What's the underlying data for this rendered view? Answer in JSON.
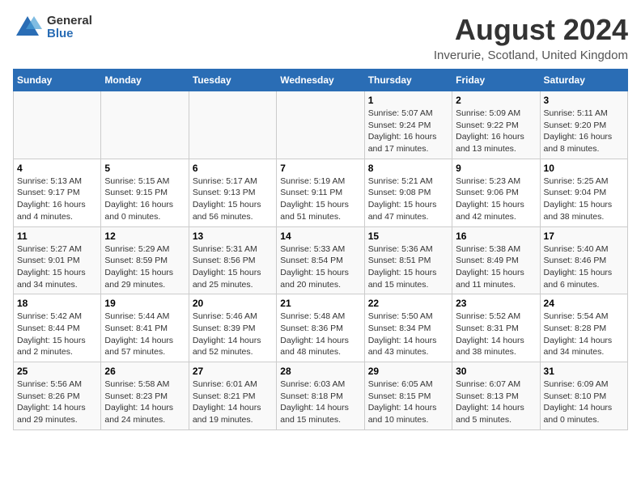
{
  "logo": {
    "general": "General",
    "blue": "Blue"
  },
  "title": "August 2024",
  "subtitle": "Inverurie, Scotland, United Kingdom",
  "days_of_week": [
    "Sunday",
    "Monday",
    "Tuesday",
    "Wednesday",
    "Thursday",
    "Friday",
    "Saturday"
  ],
  "weeks": [
    [
      {
        "day": "",
        "info": ""
      },
      {
        "day": "",
        "info": ""
      },
      {
        "day": "",
        "info": ""
      },
      {
        "day": "",
        "info": ""
      },
      {
        "day": "1",
        "info": "Sunrise: 5:07 AM\nSunset: 9:24 PM\nDaylight: 16 hours and 17 minutes."
      },
      {
        "day": "2",
        "info": "Sunrise: 5:09 AM\nSunset: 9:22 PM\nDaylight: 16 hours and 13 minutes."
      },
      {
        "day": "3",
        "info": "Sunrise: 5:11 AM\nSunset: 9:20 PM\nDaylight: 16 hours and 8 minutes."
      }
    ],
    [
      {
        "day": "4",
        "info": "Sunrise: 5:13 AM\nSunset: 9:17 PM\nDaylight: 16 hours and 4 minutes."
      },
      {
        "day": "5",
        "info": "Sunrise: 5:15 AM\nSunset: 9:15 PM\nDaylight: 16 hours and 0 minutes."
      },
      {
        "day": "6",
        "info": "Sunrise: 5:17 AM\nSunset: 9:13 PM\nDaylight: 15 hours and 56 minutes."
      },
      {
        "day": "7",
        "info": "Sunrise: 5:19 AM\nSunset: 9:11 PM\nDaylight: 15 hours and 51 minutes."
      },
      {
        "day": "8",
        "info": "Sunrise: 5:21 AM\nSunset: 9:08 PM\nDaylight: 15 hours and 47 minutes."
      },
      {
        "day": "9",
        "info": "Sunrise: 5:23 AM\nSunset: 9:06 PM\nDaylight: 15 hours and 42 minutes."
      },
      {
        "day": "10",
        "info": "Sunrise: 5:25 AM\nSunset: 9:04 PM\nDaylight: 15 hours and 38 minutes."
      }
    ],
    [
      {
        "day": "11",
        "info": "Sunrise: 5:27 AM\nSunset: 9:01 PM\nDaylight: 15 hours and 34 minutes."
      },
      {
        "day": "12",
        "info": "Sunrise: 5:29 AM\nSunset: 8:59 PM\nDaylight: 15 hours and 29 minutes."
      },
      {
        "day": "13",
        "info": "Sunrise: 5:31 AM\nSunset: 8:56 PM\nDaylight: 15 hours and 25 minutes."
      },
      {
        "day": "14",
        "info": "Sunrise: 5:33 AM\nSunset: 8:54 PM\nDaylight: 15 hours and 20 minutes."
      },
      {
        "day": "15",
        "info": "Sunrise: 5:36 AM\nSunset: 8:51 PM\nDaylight: 15 hours and 15 minutes."
      },
      {
        "day": "16",
        "info": "Sunrise: 5:38 AM\nSunset: 8:49 PM\nDaylight: 15 hours and 11 minutes."
      },
      {
        "day": "17",
        "info": "Sunrise: 5:40 AM\nSunset: 8:46 PM\nDaylight: 15 hours and 6 minutes."
      }
    ],
    [
      {
        "day": "18",
        "info": "Sunrise: 5:42 AM\nSunset: 8:44 PM\nDaylight: 15 hours and 2 minutes."
      },
      {
        "day": "19",
        "info": "Sunrise: 5:44 AM\nSunset: 8:41 PM\nDaylight: 14 hours and 57 minutes."
      },
      {
        "day": "20",
        "info": "Sunrise: 5:46 AM\nSunset: 8:39 PM\nDaylight: 14 hours and 52 minutes."
      },
      {
        "day": "21",
        "info": "Sunrise: 5:48 AM\nSunset: 8:36 PM\nDaylight: 14 hours and 48 minutes."
      },
      {
        "day": "22",
        "info": "Sunrise: 5:50 AM\nSunset: 8:34 PM\nDaylight: 14 hours and 43 minutes."
      },
      {
        "day": "23",
        "info": "Sunrise: 5:52 AM\nSunset: 8:31 PM\nDaylight: 14 hours and 38 minutes."
      },
      {
        "day": "24",
        "info": "Sunrise: 5:54 AM\nSunset: 8:28 PM\nDaylight: 14 hours and 34 minutes."
      }
    ],
    [
      {
        "day": "25",
        "info": "Sunrise: 5:56 AM\nSunset: 8:26 PM\nDaylight: 14 hours and 29 minutes."
      },
      {
        "day": "26",
        "info": "Sunrise: 5:58 AM\nSunset: 8:23 PM\nDaylight: 14 hours and 24 minutes."
      },
      {
        "day": "27",
        "info": "Sunrise: 6:01 AM\nSunset: 8:21 PM\nDaylight: 14 hours and 19 minutes."
      },
      {
        "day": "28",
        "info": "Sunrise: 6:03 AM\nSunset: 8:18 PM\nDaylight: 14 hours and 15 minutes."
      },
      {
        "day": "29",
        "info": "Sunrise: 6:05 AM\nSunset: 8:15 PM\nDaylight: 14 hours and 10 minutes."
      },
      {
        "day": "30",
        "info": "Sunrise: 6:07 AM\nSunset: 8:13 PM\nDaylight: 14 hours and 5 minutes."
      },
      {
        "day": "31",
        "info": "Sunrise: 6:09 AM\nSunset: 8:10 PM\nDaylight: 14 hours and 0 minutes."
      }
    ]
  ]
}
